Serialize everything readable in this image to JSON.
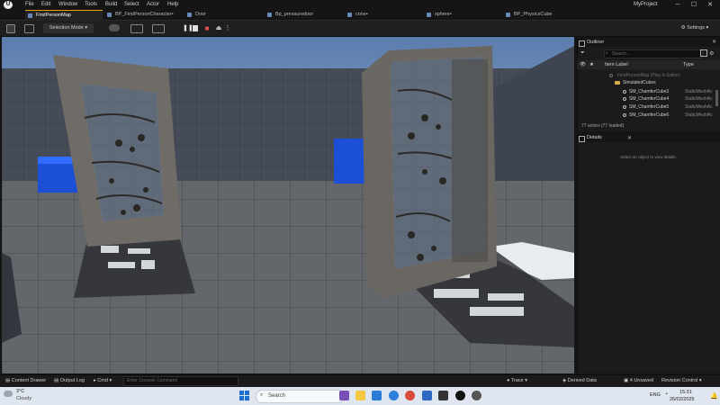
{
  "menubar": {
    "items": [
      "File",
      "Edit",
      "Window",
      "Tools",
      "Build",
      "Select",
      "Actor",
      "Help"
    ],
    "project_name": "MyProject",
    "minimize": "─",
    "maximize": "☐",
    "close": "✕"
  },
  "tabs": [
    {
      "label": "FirstPersonMap",
      "active": true
    },
    {
      "label": "BP_FirstPersonCharacter•"
    },
    {
      "label": "Door"
    },
    {
      "label": "Bp_pressuredoor"
    },
    {
      "label": "cone•"
    },
    {
      "label": "sphere•"
    },
    {
      "label": "BP_PhysicsCube"
    }
  ],
  "toolbar": {
    "selection_mode": "Selection Mode",
    "settings": "Settings"
  },
  "outliner": {
    "title": "Outliner",
    "details_title": "Details",
    "search_placeholder": "Search...",
    "col_item_label": "Item Label",
    "col_type": "Type",
    "rows": [
      {
        "label": "FirstPersonMap (Play In Editor)",
        "type": ""
      },
      {
        "label": "SimulatedCubes",
        "type": ""
      },
      {
        "label": "SM_ChamferCube3",
        "type": "StaticMeshAc"
      },
      {
        "label": "SM_ChamferCube4",
        "type": "StaticMeshAc"
      },
      {
        "label": "SM_ChamferCube5",
        "type": "StaticMeshAc"
      },
      {
        "label": "SM_ChamferCube6",
        "type": "StaticMeshAc"
      }
    ],
    "actors_count": "77 actors (77 loaded)",
    "details_empty": "Select an object to view details."
  },
  "statusbar": {
    "content_drawer": "Content Drawer",
    "output_log": "Output Log",
    "cmd": "Cmd",
    "console_placeholder": "Enter Console Command",
    "trace": "Trace",
    "derived_data": "Derived Data",
    "unsaved": "4 Unsaved",
    "revision_control": "Revision Control"
  },
  "taskbar": {
    "temp": "3°C",
    "condition": "Cloudy",
    "search": "Search",
    "lang": "ENG",
    "time": "15:31",
    "date": "26/02/2025"
  },
  "colors": {
    "accent": "#e6a000",
    "play_stop": "#e05050",
    "cube_blue": "#1a4fd6",
    "sky": "#8aa6c7"
  },
  "icons": [
    "unreal-logo-icon",
    "save-icon",
    "play-pause-icon",
    "stop-icon",
    "eject-icon",
    "gear-icon",
    "search-icon",
    "eye-icon",
    "windows-start-icon"
  ]
}
